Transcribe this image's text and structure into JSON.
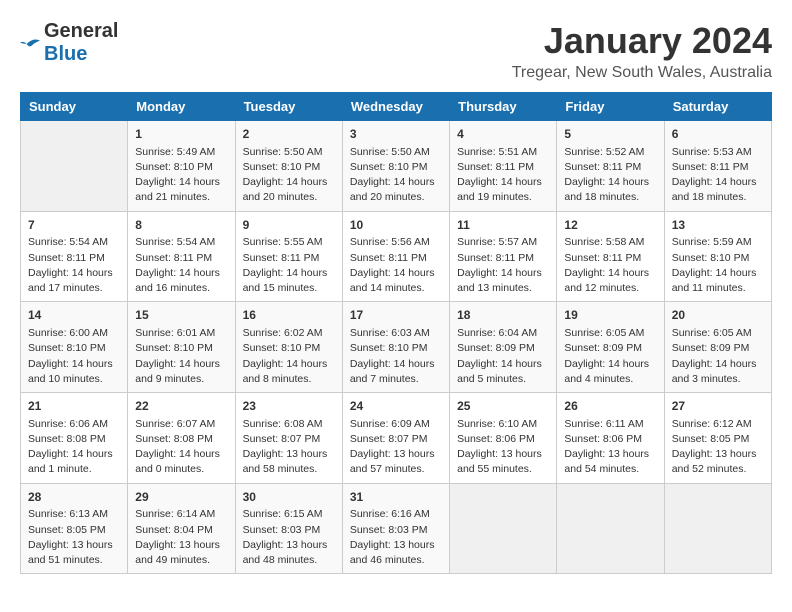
{
  "header": {
    "logo_line1": "General",
    "logo_line2": "Blue",
    "title": "January 2024",
    "subtitle": "Tregear, New South Wales, Australia"
  },
  "weekdays": [
    "Sunday",
    "Monday",
    "Tuesday",
    "Wednesday",
    "Thursday",
    "Friday",
    "Saturday"
  ],
  "weeks": [
    [
      {
        "day": "",
        "info": ""
      },
      {
        "day": "1",
        "info": "Sunrise: 5:49 AM\nSunset: 8:10 PM\nDaylight: 14 hours\nand 21 minutes."
      },
      {
        "day": "2",
        "info": "Sunrise: 5:50 AM\nSunset: 8:10 PM\nDaylight: 14 hours\nand 20 minutes."
      },
      {
        "day": "3",
        "info": "Sunrise: 5:50 AM\nSunset: 8:10 PM\nDaylight: 14 hours\nand 20 minutes."
      },
      {
        "day": "4",
        "info": "Sunrise: 5:51 AM\nSunset: 8:11 PM\nDaylight: 14 hours\nand 19 minutes."
      },
      {
        "day": "5",
        "info": "Sunrise: 5:52 AM\nSunset: 8:11 PM\nDaylight: 14 hours\nand 18 minutes."
      },
      {
        "day": "6",
        "info": "Sunrise: 5:53 AM\nSunset: 8:11 PM\nDaylight: 14 hours\nand 18 minutes."
      }
    ],
    [
      {
        "day": "7",
        "info": "Sunrise: 5:54 AM\nSunset: 8:11 PM\nDaylight: 14 hours\nand 17 minutes."
      },
      {
        "day": "8",
        "info": "Sunrise: 5:54 AM\nSunset: 8:11 PM\nDaylight: 14 hours\nand 16 minutes."
      },
      {
        "day": "9",
        "info": "Sunrise: 5:55 AM\nSunset: 8:11 PM\nDaylight: 14 hours\nand 15 minutes."
      },
      {
        "day": "10",
        "info": "Sunrise: 5:56 AM\nSunset: 8:11 PM\nDaylight: 14 hours\nand 14 minutes."
      },
      {
        "day": "11",
        "info": "Sunrise: 5:57 AM\nSunset: 8:11 PM\nDaylight: 14 hours\nand 13 minutes."
      },
      {
        "day": "12",
        "info": "Sunrise: 5:58 AM\nSunset: 8:11 PM\nDaylight: 14 hours\nand 12 minutes."
      },
      {
        "day": "13",
        "info": "Sunrise: 5:59 AM\nSunset: 8:10 PM\nDaylight: 14 hours\nand 11 minutes."
      }
    ],
    [
      {
        "day": "14",
        "info": "Sunrise: 6:00 AM\nSunset: 8:10 PM\nDaylight: 14 hours\nand 10 minutes."
      },
      {
        "day": "15",
        "info": "Sunrise: 6:01 AM\nSunset: 8:10 PM\nDaylight: 14 hours\nand 9 minutes."
      },
      {
        "day": "16",
        "info": "Sunrise: 6:02 AM\nSunset: 8:10 PM\nDaylight: 14 hours\nand 8 minutes."
      },
      {
        "day": "17",
        "info": "Sunrise: 6:03 AM\nSunset: 8:10 PM\nDaylight: 14 hours\nand 7 minutes."
      },
      {
        "day": "18",
        "info": "Sunrise: 6:04 AM\nSunset: 8:09 PM\nDaylight: 14 hours\nand 5 minutes."
      },
      {
        "day": "19",
        "info": "Sunrise: 6:05 AM\nSunset: 8:09 PM\nDaylight: 14 hours\nand 4 minutes."
      },
      {
        "day": "20",
        "info": "Sunrise: 6:05 AM\nSunset: 8:09 PM\nDaylight: 14 hours\nand 3 minutes."
      }
    ],
    [
      {
        "day": "21",
        "info": "Sunrise: 6:06 AM\nSunset: 8:08 PM\nDaylight: 14 hours\nand 1 minute."
      },
      {
        "day": "22",
        "info": "Sunrise: 6:07 AM\nSunset: 8:08 PM\nDaylight: 14 hours\nand 0 minutes."
      },
      {
        "day": "23",
        "info": "Sunrise: 6:08 AM\nSunset: 8:07 PM\nDaylight: 13 hours\nand 58 minutes."
      },
      {
        "day": "24",
        "info": "Sunrise: 6:09 AM\nSunset: 8:07 PM\nDaylight: 13 hours\nand 57 minutes."
      },
      {
        "day": "25",
        "info": "Sunrise: 6:10 AM\nSunset: 8:06 PM\nDaylight: 13 hours\nand 55 minutes."
      },
      {
        "day": "26",
        "info": "Sunrise: 6:11 AM\nSunset: 8:06 PM\nDaylight: 13 hours\nand 54 minutes."
      },
      {
        "day": "27",
        "info": "Sunrise: 6:12 AM\nSunset: 8:05 PM\nDaylight: 13 hours\nand 52 minutes."
      }
    ],
    [
      {
        "day": "28",
        "info": "Sunrise: 6:13 AM\nSunset: 8:05 PM\nDaylight: 13 hours\nand 51 minutes."
      },
      {
        "day": "29",
        "info": "Sunrise: 6:14 AM\nSunset: 8:04 PM\nDaylight: 13 hours\nand 49 minutes."
      },
      {
        "day": "30",
        "info": "Sunrise: 6:15 AM\nSunset: 8:03 PM\nDaylight: 13 hours\nand 48 minutes."
      },
      {
        "day": "31",
        "info": "Sunrise: 6:16 AM\nSunset: 8:03 PM\nDaylight: 13 hours\nand 46 minutes."
      },
      {
        "day": "",
        "info": ""
      },
      {
        "day": "",
        "info": ""
      },
      {
        "day": "",
        "info": ""
      }
    ]
  ]
}
